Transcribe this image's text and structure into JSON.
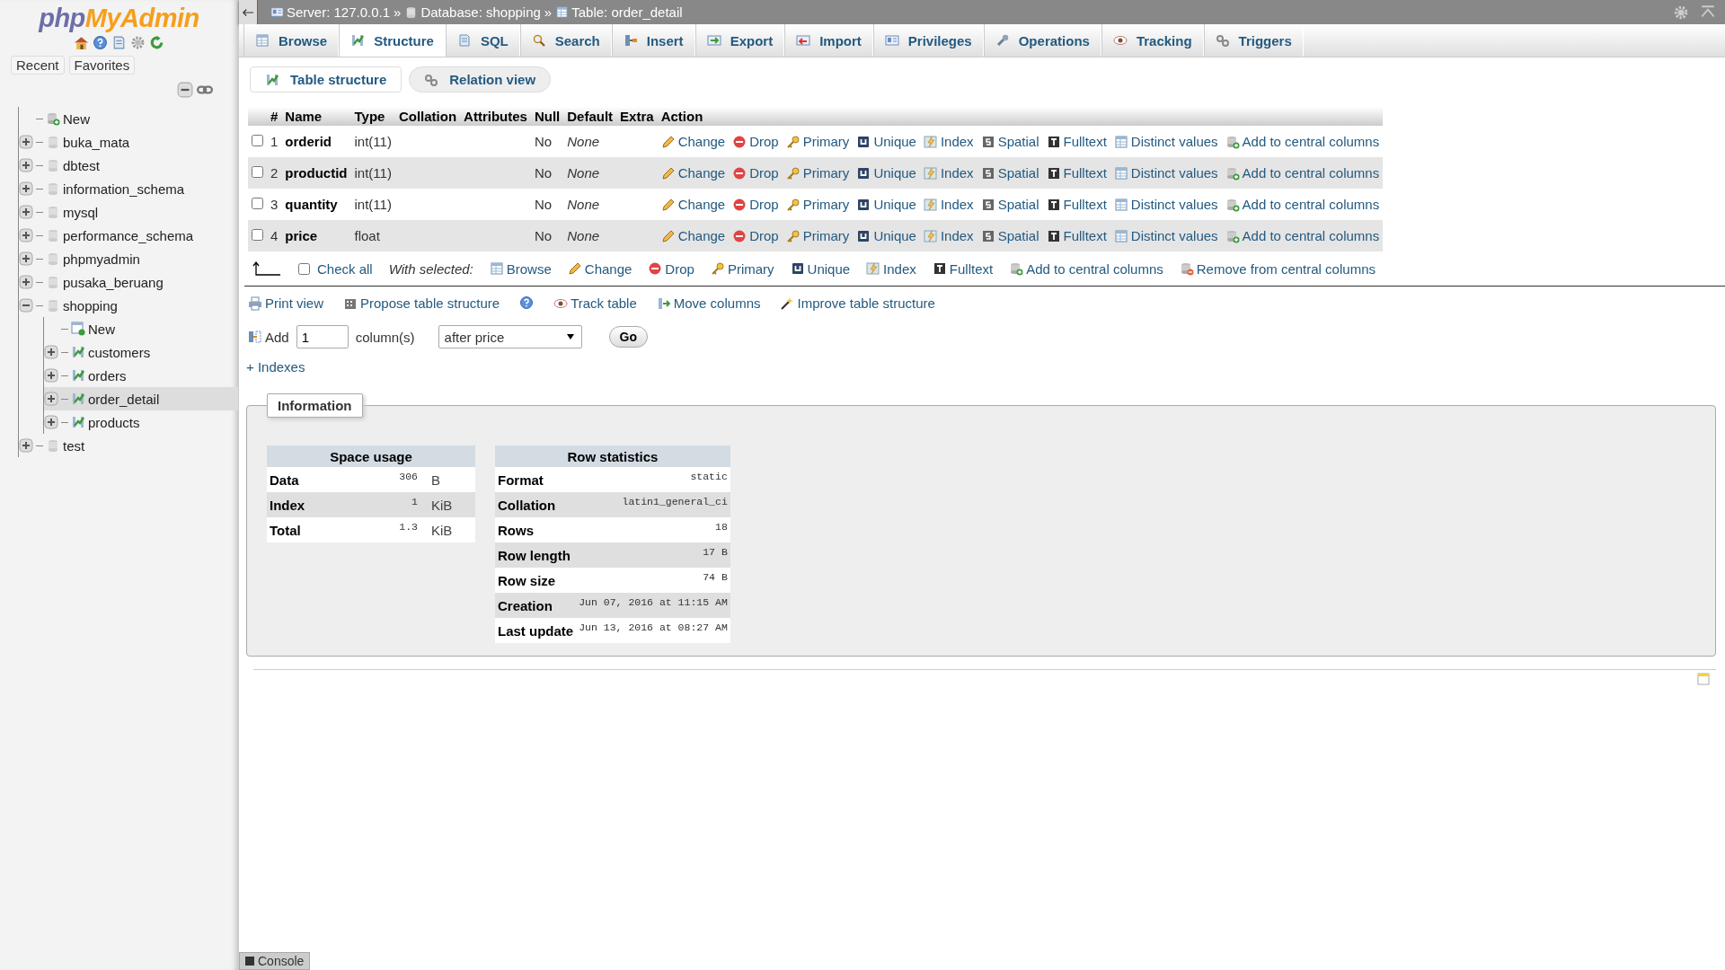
{
  "sidebar": {
    "logo": {
      "part1": "php",
      "part2": "MyAdmin"
    },
    "tabs": [
      {
        "label": "Recent"
      },
      {
        "label": "Favorites"
      }
    ],
    "tree": [
      {
        "label": "New",
        "kind": "new",
        "selected": false
      },
      {
        "label": "buka_mata",
        "kind": "db",
        "expanded": false,
        "selected": false
      },
      {
        "label": "dbtest",
        "kind": "db",
        "expanded": false,
        "selected": false
      },
      {
        "label": "information_schema",
        "kind": "db",
        "expanded": false,
        "selected": false
      },
      {
        "label": "mysql",
        "kind": "db",
        "expanded": false,
        "selected": false
      },
      {
        "label": "performance_schema",
        "kind": "db",
        "expanded": false,
        "selected": false
      },
      {
        "label": "phpmyadmin",
        "kind": "db",
        "expanded": false,
        "selected": false
      },
      {
        "label": "pusaka_beruang",
        "kind": "db",
        "expanded": false,
        "selected": false
      },
      {
        "label": "shopping",
        "kind": "db",
        "expanded": true,
        "selected": false,
        "children": [
          {
            "label": "New",
            "kind": "newtable",
            "selected": false
          },
          {
            "label": "customers",
            "kind": "table",
            "expanded": false,
            "selected": false
          },
          {
            "label": "orders",
            "kind": "table",
            "expanded": false,
            "selected": false
          },
          {
            "label": "order_detail",
            "kind": "table",
            "expanded": false,
            "selected": true
          },
          {
            "label": "products",
            "kind": "table",
            "expanded": false,
            "selected": false
          }
        ]
      },
      {
        "label": "test",
        "kind": "db",
        "expanded": false,
        "selected": false
      }
    ]
  },
  "breadcrumb": {
    "separator": "»",
    "items": [
      "Server: 127.0.0.1",
      "Database: shopping",
      "Table: order_detail"
    ]
  },
  "tabs": [
    {
      "label": "Browse",
      "selected": false
    },
    {
      "label": "Structure",
      "selected": true
    },
    {
      "label": "SQL",
      "selected": false
    },
    {
      "label": "Search",
      "selected": false
    },
    {
      "label": "Insert",
      "selected": false
    },
    {
      "label": "Export",
      "selected": false
    },
    {
      "label": "Import",
      "selected": false
    },
    {
      "label": "Privileges",
      "selected": false
    },
    {
      "label": "Operations",
      "selected": false
    },
    {
      "label": "Tracking",
      "selected": false
    },
    {
      "label": "Triggers",
      "selected": false
    }
  ],
  "subtabs": [
    {
      "label": "Table structure",
      "selected": true
    },
    {
      "label": "Relation view",
      "selected": false
    }
  ],
  "table": {
    "columns": [
      "#",
      "Name",
      "Type",
      "Collation",
      "Attributes",
      "Null",
      "Default",
      "Extra",
      "Action"
    ],
    "rows": [
      {
        "checked": false,
        "number": "1",
        "name": "orderid",
        "type": "int(11)",
        "null": "No",
        "default": "None",
        "actions": [
          "Change",
          "Drop",
          "Primary",
          "Unique",
          "Index",
          "Spatial",
          "Fulltext",
          "Distinct values",
          "Add to central columns"
        ]
      },
      {
        "checked": false,
        "number": "2",
        "name": "productid",
        "type": "int(11)",
        "null": "No",
        "default": "None",
        "actions": [
          "Change",
          "Drop",
          "Primary",
          "Unique",
          "Index",
          "Spatial",
          "Fulltext",
          "Distinct values",
          "Add to central columns"
        ]
      },
      {
        "checked": false,
        "number": "3",
        "name": "quantity",
        "type": "int(11)",
        "null": "No",
        "default": "None",
        "actions": [
          "Change",
          "Drop",
          "Primary",
          "Unique",
          "Index",
          "Spatial",
          "Fulltext",
          "Distinct values",
          "Add to central columns"
        ]
      },
      {
        "checked": false,
        "number": "4",
        "name": "price",
        "type": "float",
        "null": "No",
        "default": "None",
        "actions": [
          "Change",
          "Drop",
          "Primary",
          "Unique",
          "Index",
          "Spatial",
          "Fulltext",
          "Distinct values",
          "Add to central columns"
        ]
      }
    ]
  },
  "bulk": {
    "check_all": {
      "label": "Check all",
      "checked": false
    },
    "with_selected": "With selected:",
    "actions": [
      "Browse",
      "Change",
      "Drop",
      "Primary",
      "Unique",
      "Index",
      "Fulltext",
      "Add to central columns",
      "Remove from central columns"
    ]
  },
  "links": [
    "Print view",
    "Propose table structure",
    "Track table",
    "Move columns",
    "Improve table structure"
  ],
  "add_column": {
    "label": "Add",
    "value": "1",
    "unit": "column(s)",
    "position": "after price",
    "button": "Go"
  },
  "indexes_link": "+ Indexes",
  "information": {
    "legend": "Information",
    "space_usage": {
      "title": "Space usage",
      "rows": [
        {
          "label": "Data",
          "value": "306",
          "unit": "B"
        },
        {
          "label": "Index",
          "value": "1",
          "unit": "KiB"
        },
        {
          "label": "Total",
          "value": "1.3",
          "unit": "KiB"
        }
      ]
    },
    "row_statistics": {
      "title": "Row statistics",
      "rows": [
        {
          "label": "Format",
          "value": "static"
        },
        {
          "label": "Collation",
          "value": "latin1_general_ci"
        },
        {
          "label": "Rows",
          "value": "18"
        },
        {
          "label": "Row length",
          "value": "17 B"
        },
        {
          "label": "Row size",
          "value": "74 B"
        },
        {
          "label": "Creation",
          "value": "Jun 07, 2016 at 11:15 AM"
        },
        {
          "label": "Last update",
          "value": "Jun 13, 2016 at 08:27 AM"
        }
      ]
    }
  },
  "console": "Console"
}
